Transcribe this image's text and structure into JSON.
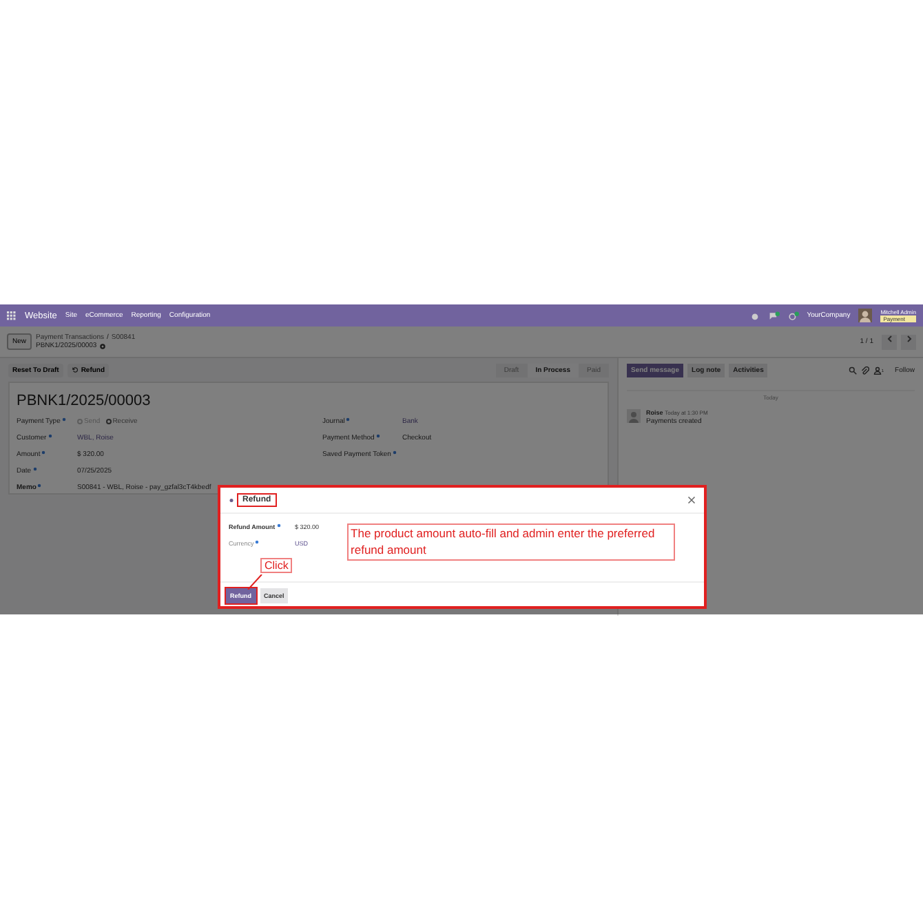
{
  "navbar": {
    "app": "Website",
    "menu": [
      "Site",
      "eCommerce",
      "Reporting",
      "Configuration"
    ],
    "company": "YourCompany",
    "user": "Mitchell Admin",
    "user_tag": "Payment"
  },
  "breadcrumb": {
    "new_button": "New",
    "parent": "Payment Transactions",
    "separator": "/",
    "record_ref": "S00841",
    "current": "PBNK1/2025/00003"
  },
  "pager": "1 / 1",
  "actions": [
    "Reset To Draft",
    "Refund"
  ],
  "stages": [
    {
      "label": "Draft",
      "selected": false
    },
    {
      "label": "In Process",
      "selected": true
    },
    {
      "label": "Paid",
      "selected": false
    }
  ],
  "chatter": {
    "buttons": [
      {
        "label": "Send message",
        "selected": true
      },
      {
        "label": "Log note",
        "selected": false
      },
      {
        "label": "Activities",
        "selected": false
      }
    ],
    "followers": "1",
    "follow": "Follow",
    "date": "Today",
    "message": {
      "author": "Roise",
      "time": "Today at 1:30 PM",
      "body": "Payments created"
    }
  },
  "form": {
    "title": "PBNK1/2025/00003",
    "left": [
      {
        "label": "Payment Type",
        "kind": "radio",
        "options": [
          {
            "label": "Send",
            "selected": false
          },
          {
            "label": "Receive",
            "selected": true
          }
        ]
      },
      {
        "label": "Customer",
        "kind": "link",
        "value": "WBL, Roise"
      },
      {
        "label": "Amount",
        "kind": "text",
        "value": "$ 320.00"
      },
      {
        "label": "Date",
        "kind": "text",
        "value": "07/25/2025"
      },
      {
        "label": "Memo",
        "kind": "text",
        "value": "S00841 - WBL, Roise - pay_gzfal3cT4kbedf"
      }
    ],
    "right": [
      {
        "label": "Journal",
        "kind": "link",
        "value": "Bank"
      },
      {
        "label": "Payment Method",
        "kind": "text",
        "value": "Checkout"
      },
      {
        "label": "Saved Payment Token"
      }
    ]
  },
  "dialog": {
    "title": "Refund",
    "fields": [
      {
        "label": "Refund Amount",
        "kind": "text",
        "value": "$ 320.00"
      },
      {
        "label": "Currency",
        "kind": "link",
        "value": "USD"
      }
    ],
    "buttons": [
      {
        "label": "Refund",
        "selected": true
      },
      {
        "label": "Cancel",
        "selected": false
      }
    ],
    "callout": "The product amount auto-fill and admin enter the preferred refund amount",
    "click_label": "Click"
  }
}
